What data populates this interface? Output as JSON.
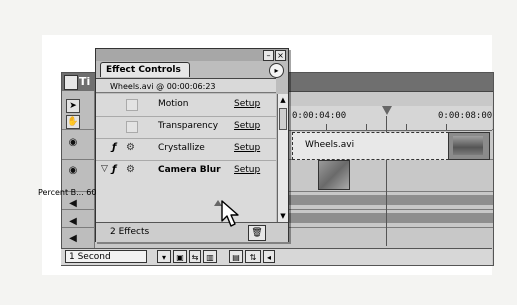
{
  "timeline": {
    "title": "Ti",
    "ruler": {
      "t1": "0:00:04:00",
      "t2": "0:00:08:00"
    },
    "clip_label": "Wheels.avi",
    "status": {
      "zoom": "1 Second"
    }
  },
  "effect_controls": {
    "tab_label": "Effect Controls",
    "clip_info": "Wheels.avi @ 00:00:06:23",
    "effects": [
      {
        "name": "Motion",
        "setup": "Setup"
      },
      {
        "name": "Transparency",
        "setup": "Setup"
      },
      {
        "name": "Crystallize",
        "setup": "Setup"
      },
      {
        "name": "Camera Blur",
        "setup": "Setup"
      }
    ],
    "param": "Percent B... 60",
    "footer_count": "2 Effects"
  },
  "icons": [
    "arrow-tool-icon",
    "hand-tool-icon",
    "eye-icon",
    "speaker-icon",
    "fx-icon",
    "gear-icon",
    "disclosure-triangle-icon",
    "trash-icon",
    "palette-menu-icon",
    "mouse-cursor-icon",
    "cti-marker-icon"
  ],
  "colors": {
    "panel": "#bdbdbd",
    "title_bar": "#6f6f6f",
    "card": "#ffffff"
  }
}
